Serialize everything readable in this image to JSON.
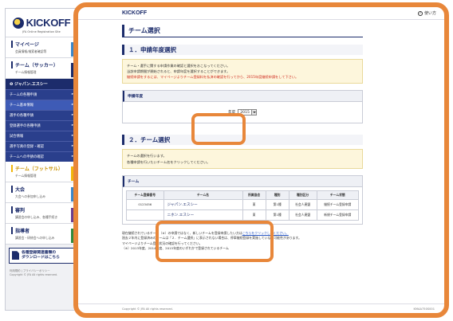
{
  "sidebar": {
    "logo_text": "KICKOFF",
    "logo_sub": "JFA Online Registration Site",
    "mypage": {
      "title": "マイページ",
      "sub": "会員情報/検索者確認等"
    },
    "team_soccer": {
      "title": "チーム（サッカー）",
      "sub": "チーム情報管理"
    },
    "team_name_head": "ジャパン.エスシー",
    "nav_items": [
      {
        "label": "チームの各種申請"
      },
      {
        "label": "チーム基本情報"
      },
      {
        "label": "選手の各種申請"
      },
      {
        "label": "登録選手の各種申請"
      },
      {
        "label": "試合情報"
      },
      {
        "label": "選手写真の登録・確認"
      },
      {
        "label": "チームへの申請の確認"
      }
    ],
    "team_futsal": {
      "title": "チーム（フットサル）",
      "sub": "チーム情報管理"
    },
    "individual": {
      "title": "大会",
      "sub": "大会への参加申し込み"
    },
    "payment": {
      "title": "審判",
      "sub": "講習会の申し込み、各種手続き"
    },
    "leader": {
      "title": "指導者",
      "sub": "講習会・研修会への申し込み"
    },
    "download": {
      "line1": "各種登録関連書類の",
      "line2": "ダウンロードはこちら"
    },
    "footer_line1": "利用規約 | プライバシーポリシー",
    "footer_line2": "Copyright © JFA All rights reserved."
  },
  "topbar": {
    "brand": "KICKOFF",
    "help": "使い方"
  },
  "main": {
    "page_title": "チーム選択",
    "section1": {
      "heading": "１．申請年度選択",
      "notice_line1": "チーム・選手に関する申請作業の確認と選択をおこなってください。",
      "notice_line2": "当該申請期間が開始されると、申請年度を選択することができます。",
      "notice_red": "継続申請をするには、マイページよりチーム登録料を払済の確認を行ってから、2015年度継続申請をして下さい。",
      "subbox_head": "申請年度",
      "year_label": "年度",
      "year_value": "2015"
    },
    "section2": {
      "heading": "２．チーム選択",
      "notice_line1": "チームの選択を行います。",
      "notice_line2": "各種申請を行いたいチーム名をクリックしてください。",
      "subbox_head": "チーム",
      "table": {
        "headers": [
          "チーム登録番号",
          "チーム名",
          "所属協会",
          "種別",
          "種別区分",
          "チーム状態"
        ],
        "rows": [
          {
            "id": "0123456",
            "name": "ジャパン.エスシー",
            "assoc": "東",
            "kind": "第1種",
            "category": "社会人連盟",
            "status": "継続チーム登録申請"
          },
          {
            "id": "",
            "name": "ニホン.エスシー",
            "assoc": "東",
            "kind": "第1種",
            "category": "社会人連盟",
            "status": "新規チーム登録申請"
          }
        ]
      }
    },
    "notes": {
      "line1_pre": "現在継続されているチーム（※）の申請ではなく、新しいチームを登録申請したい方は",
      "line1_link": "こちらをクリックしてください。",
      "line2": "過去２年内に登録済みのチームは「２．チーム選択」に表示されない場合は、停車継続登録を実施していない可能性があります。",
      "line3": "マイページよりチーム登録状況の確認を行ってください。",
      "line4": "（※）2013年度、2014年度、2015年度のいずれかで登録されているチーム"
    },
    "footer_left": "Copyright © JFA All rights reserved.",
    "footer_right": "KMAA750S001"
  },
  "colors": {
    "navy": "#1c2c6b",
    "orange_highlight": "#e8873a",
    "notice_bg": "#fdf6dc",
    "red_text": "#d02a1e"
  }
}
